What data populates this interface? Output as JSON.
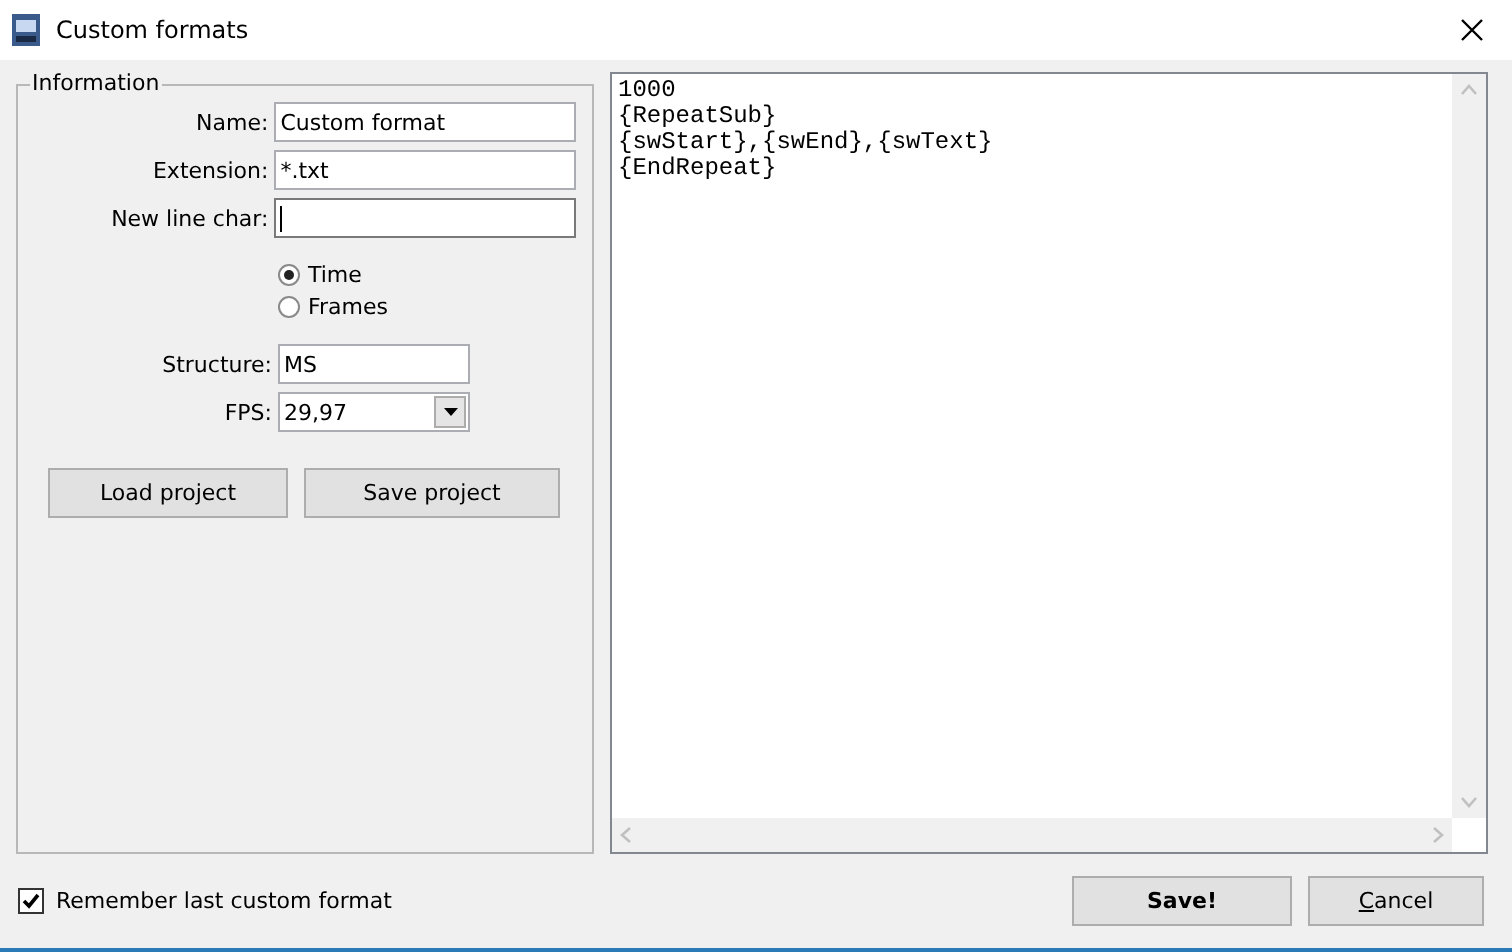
{
  "window": {
    "title": "Custom formats"
  },
  "information": {
    "title": "Information",
    "fields": [
      {
        "label": "Name:",
        "value": "Custom format"
      },
      {
        "label": "Extension:",
        "value": "*.txt"
      },
      {
        "label": "New line char:",
        "focused": true
      }
    ],
    "mode": [
      {
        "label": "Time",
        "selected": true
      },
      {
        "label": "Frames",
        "selected": false
      }
    ],
    "structure": {
      "label": "Structure:",
      "value": "MS"
    },
    "fps": {
      "label": "FPS:",
      "value": "29,97"
    },
    "buttons": [
      "Load project",
      "Save project"
    ]
  },
  "editor": {
    "lines": [
      "1000",
      "{RepeatSub}",
      "{swStart},{swEnd},{swText}",
      "{EndRepeat}"
    ]
  },
  "remember": {
    "label": "Remember last custom format",
    "checked": true
  },
  "buttons": [
    {
      "label": "Save!",
      "kind": "default"
    },
    {
      "label": "Cancel",
      "kind": "cancel"
    }
  ]
}
